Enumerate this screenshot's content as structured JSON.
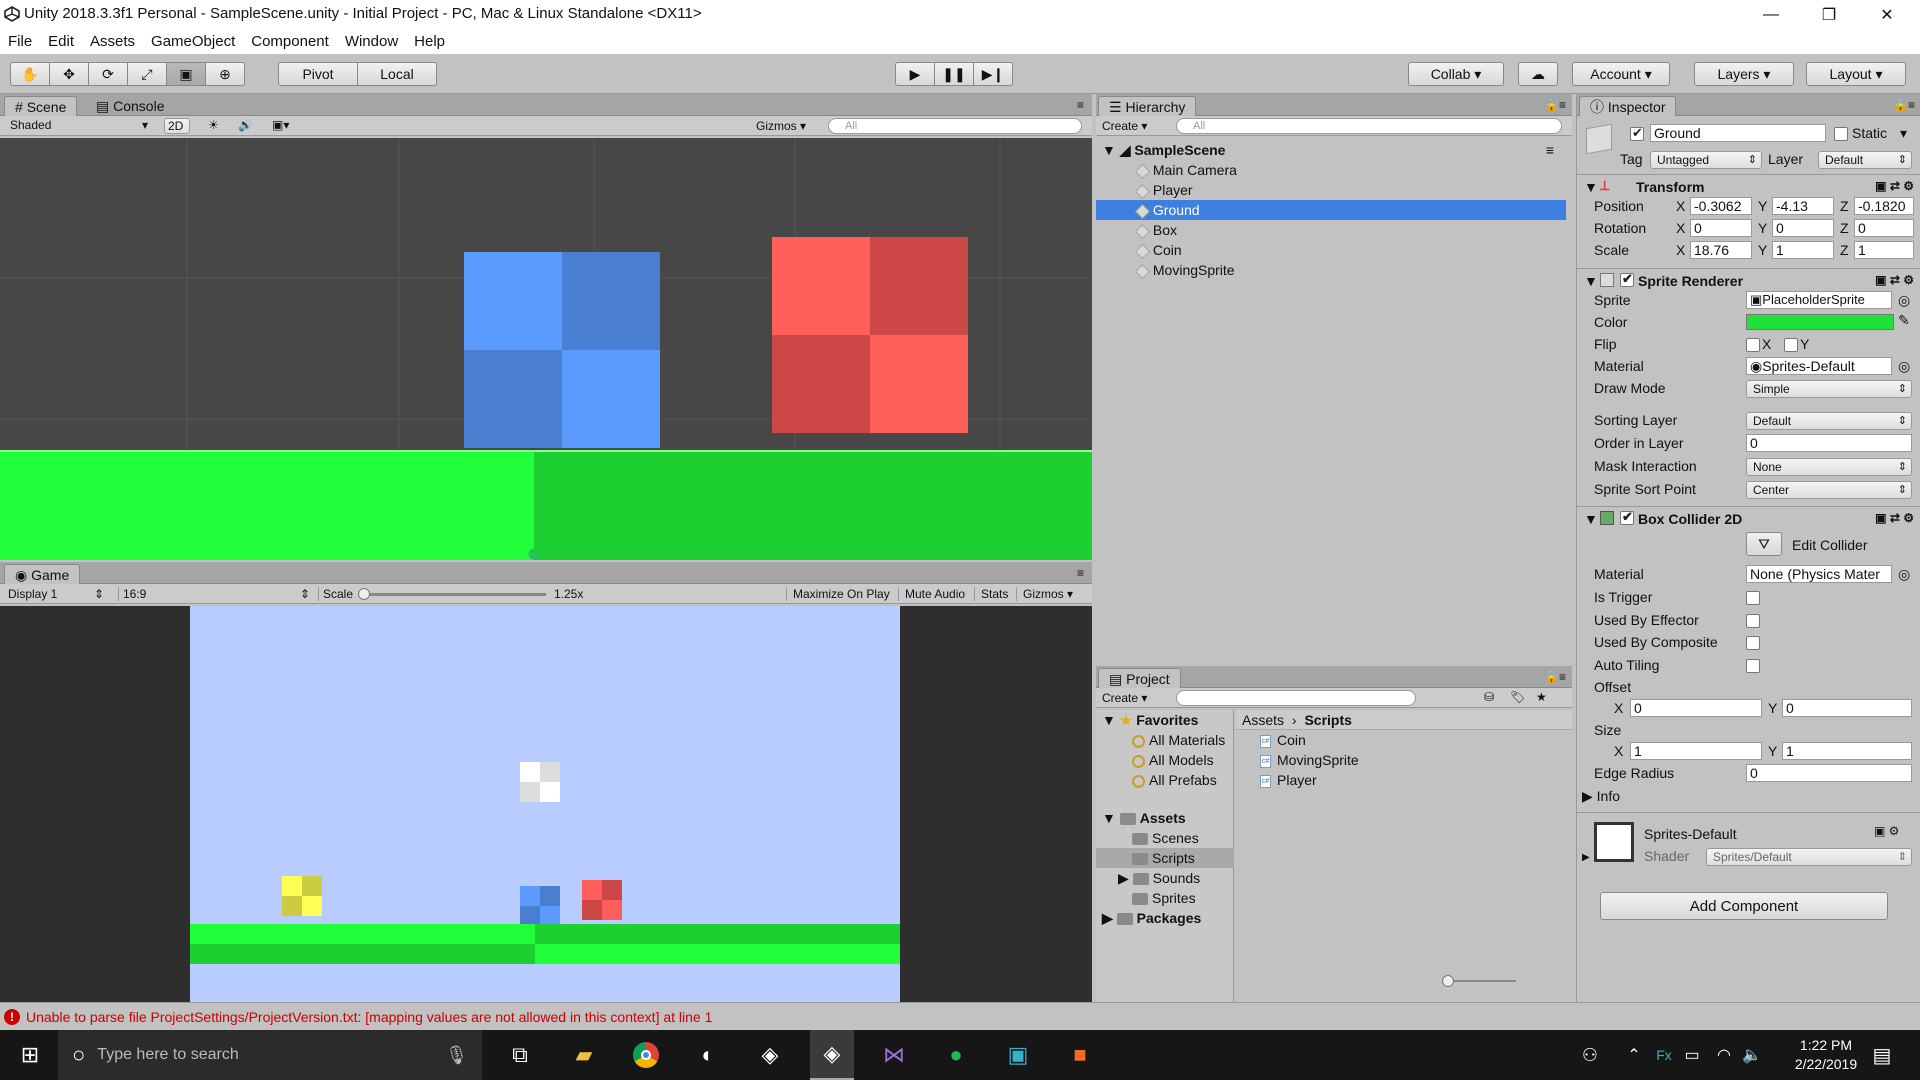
{
  "window": {
    "title": "Unity 2018.3.3f1 Personal - SampleScene.unity - Initial Project - PC, Mac & Linux Standalone <DX11>",
    "minimize": "—",
    "maximize": "❐",
    "close": "✕"
  },
  "menu": [
    "File",
    "Edit",
    "Assets",
    "GameObject",
    "Component",
    "Window",
    "Help"
  ],
  "toolbar": {
    "tools": [
      "hand-tool-icon",
      "move-tool-icon",
      "rotate-tool-icon",
      "scale-tool-icon",
      "rect-tool-icon",
      "transform-tool-icon"
    ],
    "pivot": "Pivot",
    "local": "Local",
    "play": "▶",
    "pause": "❚❚",
    "step": "▶❙",
    "collab": "Collab",
    "account": "Account",
    "layers": "Layers",
    "layout": "Layout"
  },
  "scene": {
    "tab": "Scene",
    "console_tab": "Console",
    "shading": "Shaded",
    "mode_2d": "2D",
    "gizmos": "Gizmos",
    "search_placeholder": "All"
  },
  "game": {
    "tab": "Game",
    "display": "Display 1",
    "aspect": "16:9",
    "scale_label": "Scale",
    "scale_value": "1.25x",
    "scale_level": 0.0,
    "maximize": "Maximize On Play",
    "mute": "Mute Audio",
    "stats": "Stats",
    "gizmos": "Gizmos"
  },
  "hierarchy": {
    "tab": "Hierarchy",
    "create": "Create",
    "search_placeholder": "All",
    "scene": "SampleScene",
    "items": [
      {
        "label": "Main Camera",
        "selected": false
      },
      {
        "label": "Player",
        "selected": false
      },
      {
        "label": "Ground",
        "selected": true
      },
      {
        "label": "Box",
        "selected": false
      },
      {
        "label": "Coin",
        "selected": false
      },
      {
        "label": "MovingSprite",
        "selected": false
      }
    ]
  },
  "project": {
    "tab": "Project",
    "create": "Create",
    "favorites": "Favorites",
    "fav_items": [
      "All Materials",
      "All Models",
      "All Prefabs"
    ],
    "assets": "Assets",
    "asset_folders": [
      "Scenes",
      "Scripts",
      "Sounds",
      "Sprites"
    ],
    "packages": "Packages",
    "breadcrumb_root": "Assets",
    "breadcrumb_sep": "›",
    "breadcrumb_current": "Scripts",
    "files": [
      "Coin",
      "MovingSprite",
      "Player"
    ]
  },
  "inspector": {
    "tab": "Inspector",
    "object_name": "Ground",
    "static_label": "Static",
    "tag_label": "Tag",
    "tag_value": "Untagged",
    "layer_label": "Layer",
    "layer_value": "Default",
    "transform": {
      "title": "Transform",
      "position_label": "Position",
      "position": [
        "-0.3062",
        "-4.13",
        "-0.1820"
      ],
      "rotation_label": "Rotation",
      "rotation": [
        "0",
        "0",
        "0"
      ],
      "scale_label": "Scale",
      "scale": [
        "18.76",
        "1",
        "1"
      ],
      "x": "X",
      "y": "Y",
      "z": "Z"
    },
    "sprite_renderer": {
      "title": "Sprite Renderer",
      "sprite_label": "Sprite",
      "sprite_value": "PlaceholderSprite",
      "color_label": "Color",
      "color_value": "#22e03a",
      "flip_label": "Flip",
      "flip_x": "X",
      "flip_y": "Y",
      "material_label": "Material",
      "material_value": "Sprites-Default",
      "draw_mode_label": "Draw Mode",
      "draw_mode_value": "Simple",
      "sorting_layer_label": "Sorting Layer",
      "sorting_layer_value": "Default",
      "order_label": "Order in Layer",
      "order_value": "0",
      "mask_label": "Mask Interaction",
      "mask_value": "None",
      "sort_point_label": "Sprite Sort Point",
      "sort_point_value": "Center"
    },
    "box_collider": {
      "title": "Box Collider 2D",
      "edit_collider": "Edit Collider",
      "material_label": "Material",
      "material_value": "None (Physics Mater",
      "is_trigger": "Is Trigger",
      "used_by_effector": "Used By Effector",
      "used_by_composite": "Used By Composite",
      "auto_tiling": "Auto Tiling",
      "offset_label": "Offset",
      "offset_x": "0",
      "offset_y": "0",
      "size_label": "Size",
      "size_x": "1",
      "size_y": "1",
      "edge_radius_label": "Edge Radius",
      "edge_radius_value": "0",
      "info": "Info",
      "x": "X",
      "y": "Y"
    },
    "material": {
      "name": "Sprites-Default",
      "shader_label": "Shader",
      "shader_value": "Sprites/Default"
    },
    "add_component": "Add Component"
  },
  "status": {
    "error": "Unable to parse file ProjectSettings/ProjectVersion.txt: [mapping values are not allowed in this context] at line 1"
  },
  "taskbar": {
    "search_placeholder": "Type here to search",
    "time": "1:22 PM",
    "date": "2/22/2019"
  },
  "colors": {
    "accent_selection": "#3d80df",
    "ground_green": "#22ff3a",
    "ground_dark": "#1bd030",
    "blue_light": "#5b9bff",
    "blue_dark": "#4a7ed0",
    "red_light": "#ff5f5b",
    "red_dark": "#cc4745",
    "sky": "#b8ccff",
    "error_red": "#cc0000"
  }
}
